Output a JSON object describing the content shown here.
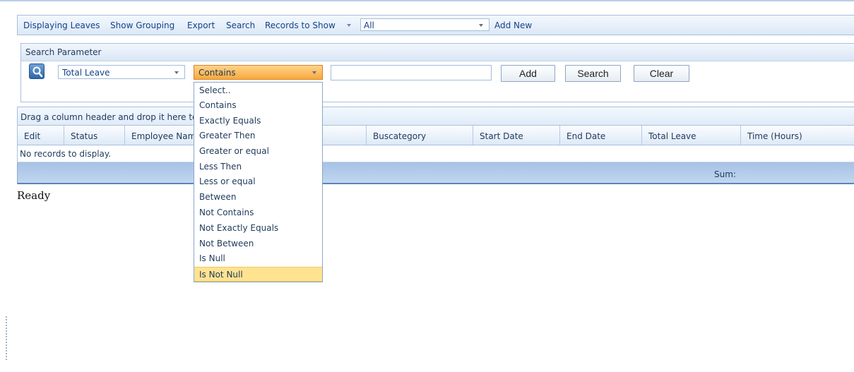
{
  "toolbar": {
    "displaying": "Displaying Leaves",
    "show_grouping": "Show Grouping",
    "export": "Export",
    "search": "Search",
    "records_to_show": "Records to Show",
    "records_value": "All",
    "add_new": "Add New"
  },
  "search_panel": {
    "title": "Search Parameter",
    "field_value": "Total Leave",
    "operator_value": "Contains",
    "value_input": "",
    "add_label": "Add",
    "search_label": "Search",
    "clear_label": "Clear"
  },
  "operator_options": [
    "Select..",
    "Contains",
    "Exactly Equals",
    "Greater Then",
    "Greater or equal",
    "Less Then",
    "Less or equal",
    "Between",
    "Not Contains",
    "Not Exactly Equals",
    "Not Between",
    "Is Null",
    "Is Not Null"
  ],
  "grid": {
    "group_hint": "Drag a column header and drop it here to",
    "columns": [
      "Edit",
      "Status",
      "Employee Name",
      "",
      "Buscategory",
      "Start Date",
      "End Date",
      "Total Leave",
      "Time (Hours)"
    ],
    "no_records": "No records to display.",
    "sum_label": "Sum:"
  },
  "status": "Ready",
  "colors": {
    "accent": "#f8a93c",
    "highlight": "#ffe391",
    "header_blue": "#15428b"
  }
}
